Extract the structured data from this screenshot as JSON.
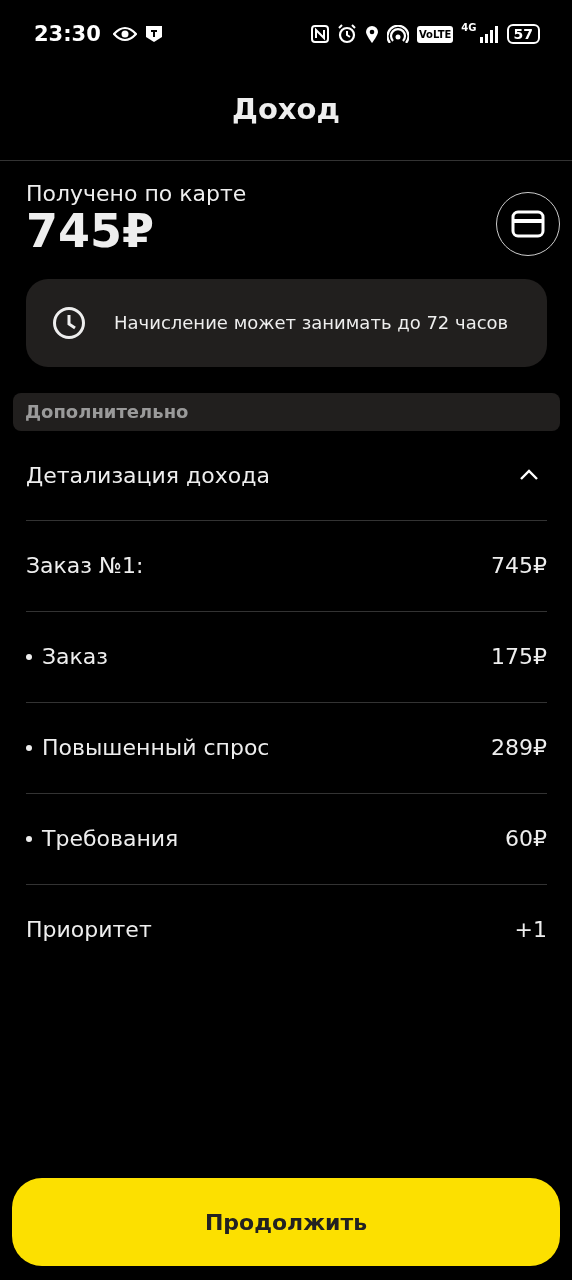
{
  "status_bar": {
    "time": "23:30",
    "volte": "VoLTE",
    "network": "4G",
    "battery": "57"
  },
  "header": {
    "title": "Доход"
  },
  "summary": {
    "label": "Получено по карте",
    "amount": "745₽"
  },
  "notice": {
    "text": "Начисление может занимать до 72 часов"
  },
  "section": {
    "title": "Дополнительно"
  },
  "details": {
    "title": "Детализация дохода",
    "expanded": true,
    "rows": [
      {
        "label": "Заказ №1:",
        "value": "745₽",
        "bulleted": false
      },
      {
        "label": "Заказ",
        "value": "175₽",
        "bulleted": true
      },
      {
        "label": "Повышенный спрос",
        "value": "289₽",
        "bulleted": true
      },
      {
        "label": "Требования",
        "value": "60₽",
        "bulleted": true
      },
      {
        "label": "Приоритет",
        "value": "+1",
        "bulleted": false
      }
    ]
  },
  "button": {
    "label": "Продолжить"
  }
}
